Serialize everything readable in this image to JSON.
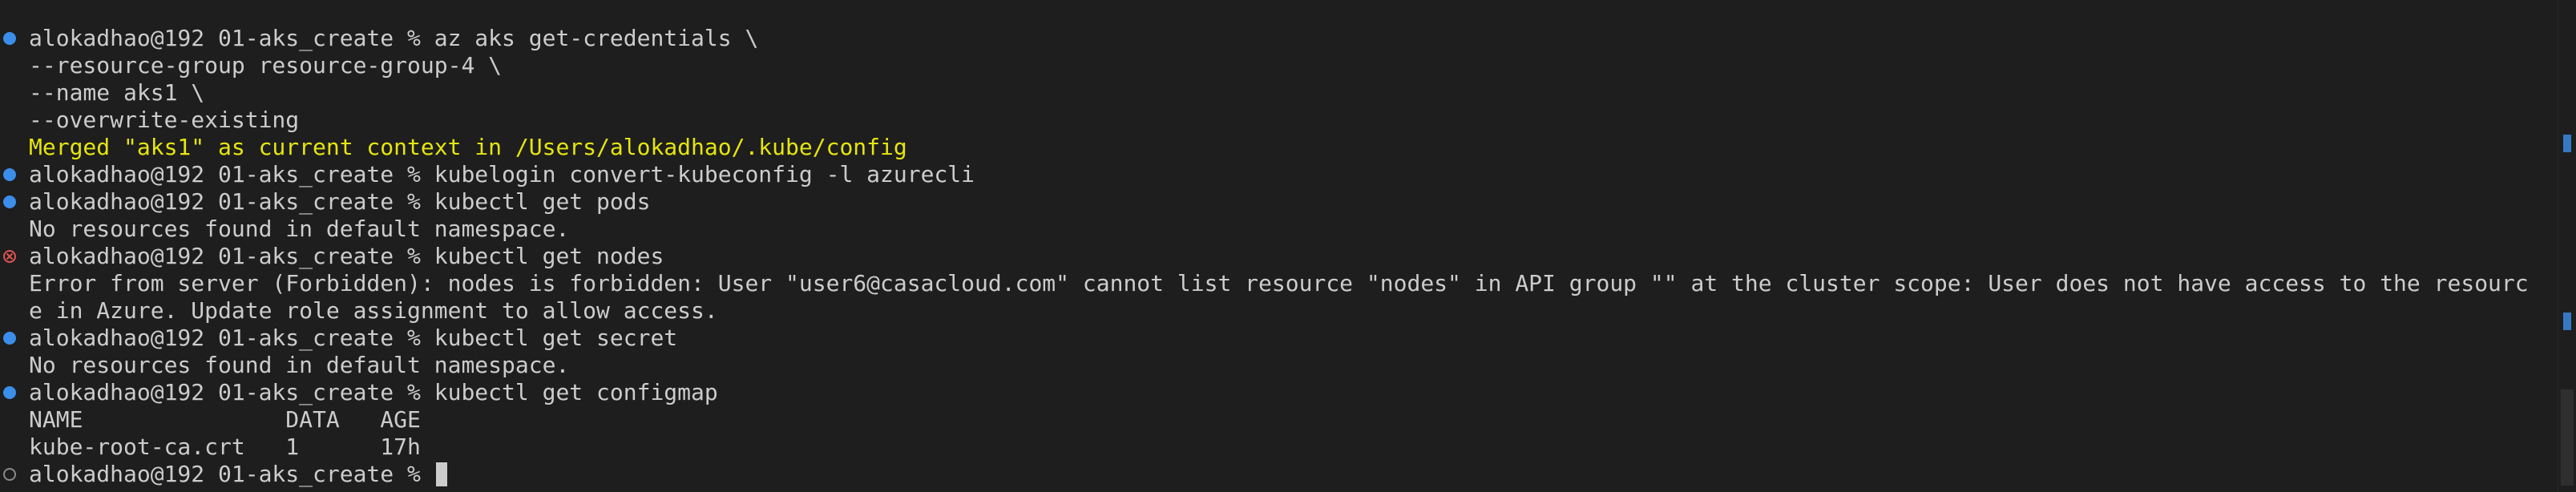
{
  "terminal": {
    "lines": [
      {
        "status": "success",
        "text": "alokadhao@192 01-aks_create % az aks get-credentials \\"
      },
      {
        "status": "",
        "text": "--resource-group resource-group-4 \\"
      },
      {
        "status": "",
        "text": "--name aks1 \\"
      },
      {
        "status": "",
        "text": "--overwrite-existing"
      },
      {
        "status": "",
        "text": "Merged \"aks1\" as current context in /Users/alokadhao/.kube/config",
        "color": "yellow"
      },
      {
        "status": "success",
        "text": "alokadhao@192 01-aks_create % kubelogin convert-kubeconfig -l azurecli"
      },
      {
        "status": "success",
        "text": "alokadhao@192 01-aks_create % kubectl get pods"
      },
      {
        "status": "",
        "text": "No resources found in default namespace."
      },
      {
        "status": "error",
        "text": "alokadhao@192 01-aks_create % kubectl get nodes"
      },
      {
        "status": "",
        "text": "Error from server (Forbidden): nodes is forbidden: User \"user6@casacloud.com\" cannot list resource \"nodes\" in API group \"\" at the cluster scope: User does not have access to the resourc"
      },
      {
        "status": "",
        "text": "e in Azure. Update role assignment to allow access."
      },
      {
        "status": "success",
        "text": "alokadhao@192 01-aks_create % kubectl get secret"
      },
      {
        "status": "",
        "text": "No resources found in default namespace."
      },
      {
        "status": "success",
        "text": "alokadhao@192 01-aks_create % kubectl get configmap"
      },
      {
        "status": "",
        "text": "NAME               DATA   AGE"
      },
      {
        "status": "",
        "text": "kube-root-ca.crt   1      17h"
      },
      {
        "status": "pending",
        "text": "alokadhao@192 01-aks_create % ",
        "cursor": true
      }
    ]
  },
  "colors": {
    "background": "#1e1e1e",
    "foreground": "#cccccc",
    "yellow": "#e5e510",
    "success_marker": "#3b8eea",
    "error_marker": "#e15454"
  }
}
